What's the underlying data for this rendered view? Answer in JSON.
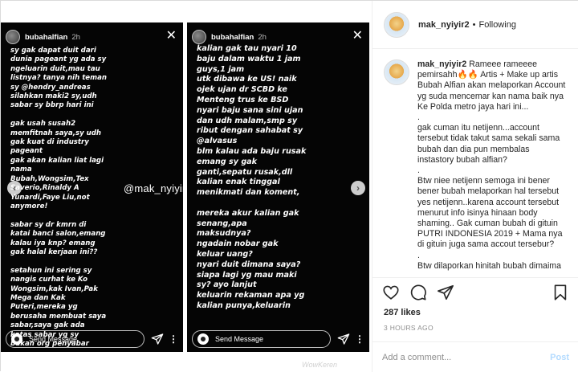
{
  "story_left": {
    "username": "bubahalfian",
    "time": "2h",
    "text": "sy gak dapat duit dari\ndunia pageant yg ada sy\nngeluarin duit,mau tau\nlistnya? tanya nih teman\nsy @hendry_andreas\nsilahkan maki2 sy,udh\nsabar sy bbrp hari ini\n\ngak usah susah2\nmemfitnah saya,sy udh\ngak kuat di industry\npageant\ngak akan kalian liat lagi\nnama\nBubah,Wongsim,Tex\nSaverio,Rinaldy A\nYunardi,Faye Liu,not\nanymore!\n\nsabar sy dr kmrn di\nkatai banci salon,emang\nkalau iya knp? emang\ngak halal kerjaan ini??\n\nsetahun ini sering sy\nnangis curhat ke Ko\nWongsim,kak Ivan,Pak\nMega dan Kak\nPuteri,mereka yg\nberusaha membuat saya\nsabar,saya gak ada\nkatas sabar yg sy\nbukan org penyabar",
    "send_label": "Send Message"
  },
  "story_right": {
    "username": "bubahalfian",
    "time": "2h",
    "text": "kalian gak tau nyari 10\nbaju dalam waktu 1 jam\nguys,1 jam\nutk dibawa ke US! naik\nojek ujan dr SCBD ke\nMenteng trus ke BSD\nnyari baju sana sini ujan\ndan udh malam,smp sy\nribut dengan sahabat sy\n@alvasus\nblm kalau ada baju rusak\nemang sy gak\nganti,sepatu rusak,dll\nkalian enak tinggal\nmenikmati dan koment,\n\nmereka akur kalian gak\nsenang,apa\nmaksudnya?\nngadain nobar gak\nkeluar uang?\nnyari duit dimana saya?\nsiapa lagi yg mau maki\nsy? ayo lanjut\nkeluarin rekaman apa yg\nkalian punya,keluarin",
    "send_label": "Send Message"
  },
  "media_watermark": "@mak_nyiyir",
  "bottom_watermark": "WowKeren",
  "header": {
    "username": "mak_nyiyir2",
    "separator": "•",
    "follow_label": "Following"
  },
  "caption": {
    "username": "mak_nyiyir2",
    "text": " Rameee rameeee pemirsahh🔥🔥 Artis + Make up artis Bubah Alfian akan melaporkan Account yg suda mencemar kan nama baik nya Ke Polda metro jaya hari ini...\n.\ngak cuman itu netijenn...account tersebut tidak takut sama sekali sama bubah dan dia pun membalas instastory bubah alfian?\n.\nBtw niee netijenn semoga ini bener bener bubah melaporkan hal tersebut yes netijenn..karena account tersebut menurut info isinya hinaan body shaming.. Gak cuman bubah di gituin PUTRI INDONESIA 2019 + Mama nya di gituin juga sama accout tersebur?\n.\nBtw dilaporkan hinitah bubah dimaima"
  },
  "likes": "287 likes",
  "time_ago": "3 HOURS AGO",
  "comment_box": {
    "placeholder": "Add a comment...",
    "post_label": "Post"
  }
}
